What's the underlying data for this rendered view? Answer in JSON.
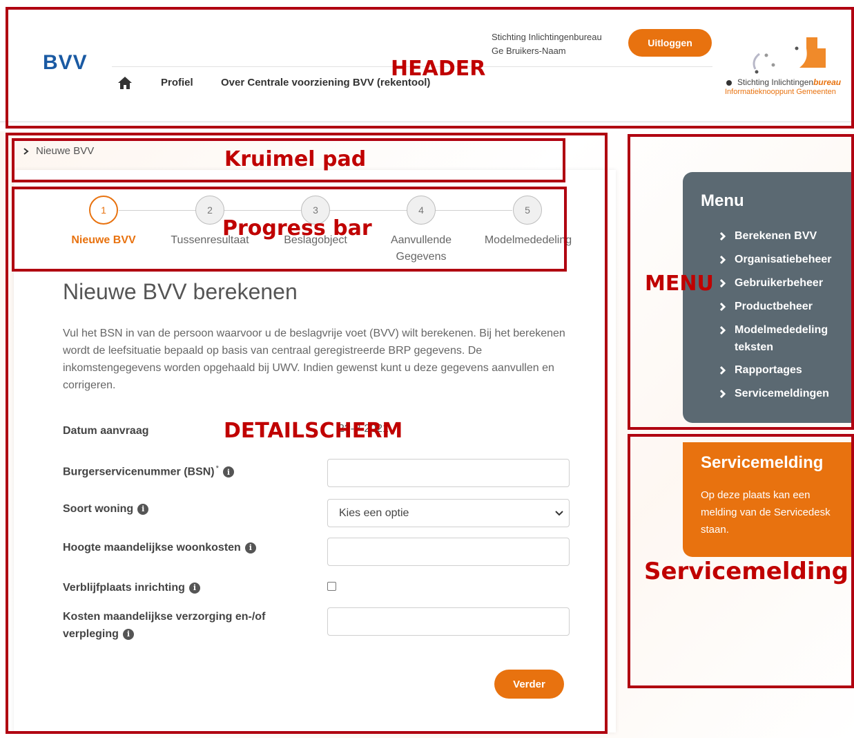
{
  "header": {
    "logo": "BVV",
    "org_name": "Stichting Inlichtingenbureau",
    "user_name": "Ge Bruikers-Naam",
    "logout_label": "Uitloggen",
    "nav": {
      "home_icon": "home-icon",
      "profile": "Profiel",
      "about": "Over Centrale voorziening BVV (rekentool)"
    },
    "sib_logo": {
      "line1_plain": "Stichting Inlichtingen",
      "line1_accent": "bureau",
      "line2": "Informatieknooppunt Gemeenten"
    }
  },
  "breadcrumb": {
    "item": "Nieuwe BVV"
  },
  "progress": {
    "steps": [
      {
        "number": "1",
        "label": "Nieuwe BVV",
        "active": true
      },
      {
        "number": "2",
        "label": "Tussenresultaat",
        "active": false
      },
      {
        "number": "3",
        "label": "Beslagobject",
        "active": false
      },
      {
        "number": "4",
        "label_line1": "Aanvullende",
        "label_line2": "Gegevens",
        "active": false
      },
      {
        "number": "5",
        "label": "Modelmededeling",
        "active": false
      }
    ]
  },
  "form": {
    "title": "Nieuwe BVV berekenen",
    "intro": "Vul het BSN in van de persoon waarvoor u de beslagvrije voet (BVV) wilt berekenen. Bij het berekenen wordt de leefsituatie bepaald op basis van centraal geregistreerde BRP gegevens. De inkomstengegevens worden opgehaald bij UWV. Indien gewenst kunt u deze gegevens aanvullen en corrigeren.",
    "date_label": "Datum aanvraag",
    "date_value": "2?-?-2021",
    "bsn_label": "Burgerservicenummer (BSN)",
    "bsn_required": "*",
    "bsn_value": "",
    "woning_label": "Soort woning",
    "woning_selected": "Kies een optie",
    "woonkosten_label": "Hoogte maandelijkse woonkosten",
    "woonkosten_value": "",
    "inrichting_label": "Verblijfplaats inrichting",
    "inrichting_checked": false,
    "verzorging_label_line1": "Kosten maandelijkse verzorging en-/of",
    "verzorging_label_line2": "verpleging",
    "verzorging_value": "",
    "next_label": "Verder"
  },
  "menu": {
    "title": "Menu",
    "items": [
      "Berekenen BVV",
      "Organisatiebeheer",
      "Gebruikerbeheer",
      "Productbeheer",
      "Modelmededeling teksten",
      "Rapportages",
      "Servicemeldingen"
    ]
  },
  "service": {
    "title": "Servicemelding",
    "text": "Op deze plaats kan een melding van de Servicedesk staan."
  },
  "annotations": {
    "header": "HEADER",
    "breadcrumb": "Kruimel pad",
    "progress": "Progress bar",
    "menu": "MENU",
    "detail": "DETAILSCHERM",
    "service": "Servicemelding"
  },
  "colors": {
    "accent": "#e8720f",
    "brand_blue": "#1a5aa3",
    "menu_bg": "#5b6972",
    "annotation_red": "#c00000"
  }
}
